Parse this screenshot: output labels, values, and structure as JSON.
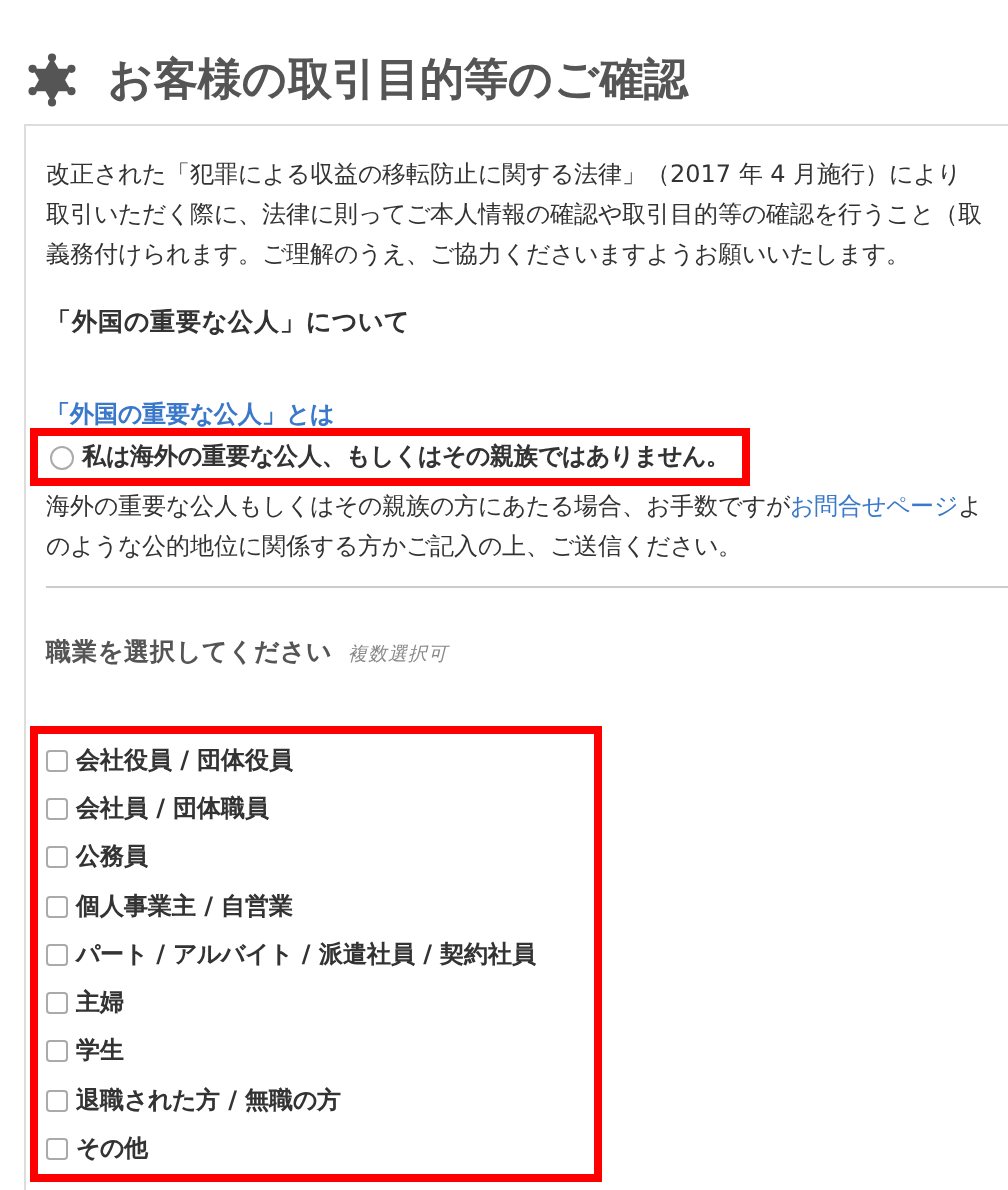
{
  "title": "お客様の取引目的等のご確認",
  "intro": [
    "改正された「犯罪による収益の移転防止に関する法律」（2017 年 4 月施行）により",
    "取引いただく際に、法律に則ってご本人情報の確認や取引目的等の確認を行うこと（取",
    "義務付けられます。ご理解のうえ、ご協力くださいますようお願いいたします。"
  ],
  "pep_heading": "「外国の重要な公人」について",
  "pep_link": "「外国の重要な公人」とは",
  "pep_radio": {
    "label": "私は海外の重要な公人、もしくはその親族ではありません。",
    "selected": false,
    "highlighted": true
  },
  "pep_note": {
    "before": "海外の重要な公人もしくはその親族の方にあたる場合、お手数ですが",
    "link": "お問合せページ",
    "after": "よ",
    "line2": "のような公的地位に関係する方かご記入の上、ご送信ください。"
  },
  "occupation": {
    "heading": "職業を選択してください",
    "hint": "複数選択可",
    "highlighted": true,
    "options": [
      {
        "label": "会社役員 / 団体役員",
        "checked": false
      },
      {
        "label": "会社員 / 団体職員",
        "checked": false
      },
      {
        "label": "公務員",
        "checked": false
      },
      {
        "label": "個人事業主 / 自営業",
        "checked": false
      },
      {
        "label": "パート / アルバイト / 派遣社員 / 契約社員",
        "checked": false
      },
      {
        "label": "主婦",
        "checked": false
      },
      {
        "label": "学生",
        "checked": false
      },
      {
        "label": "退職された方 / 無職の方",
        "checked": false
      },
      {
        "label": "その他",
        "checked": false
      }
    ]
  }
}
